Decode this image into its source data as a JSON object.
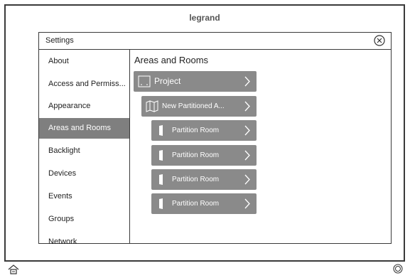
{
  "brand": "legrand",
  "dialog": {
    "title": "Settings"
  },
  "sidebar": {
    "items": [
      {
        "label": "About"
      },
      {
        "label": "Access and Permiss..."
      },
      {
        "label": "Appearance"
      },
      {
        "label": "Areas and Rooms"
      },
      {
        "label": "Backlight"
      },
      {
        "label": "Devices"
      },
      {
        "label": "Events"
      },
      {
        "label": "Groups"
      },
      {
        "label": "Network"
      }
    ],
    "selected": "Areas and Rooms"
  },
  "main": {
    "title": "Areas and Rooms",
    "tree": [
      {
        "label": "Project",
        "icon": "project-icon"
      },
      {
        "label": "New Partitioned A...",
        "icon": "partitioned-area-icon"
      },
      {
        "label": "Partition Room",
        "icon": "partition-room-icon"
      },
      {
        "label": "Partition Room",
        "icon": "partition-room-icon"
      },
      {
        "label": "Partition Room",
        "icon": "partition-room-icon"
      },
      {
        "label": "Partition Room",
        "icon": "partition-room-icon"
      }
    ]
  },
  "footer": {
    "home_icon": "home-icon",
    "power_icon": "power-icon"
  },
  "colors": {
    "selected_bg": "#7f7f7f",
    "node_bg": "#8a8a8a",
    "border": "#3a3a3a"
  }
}
